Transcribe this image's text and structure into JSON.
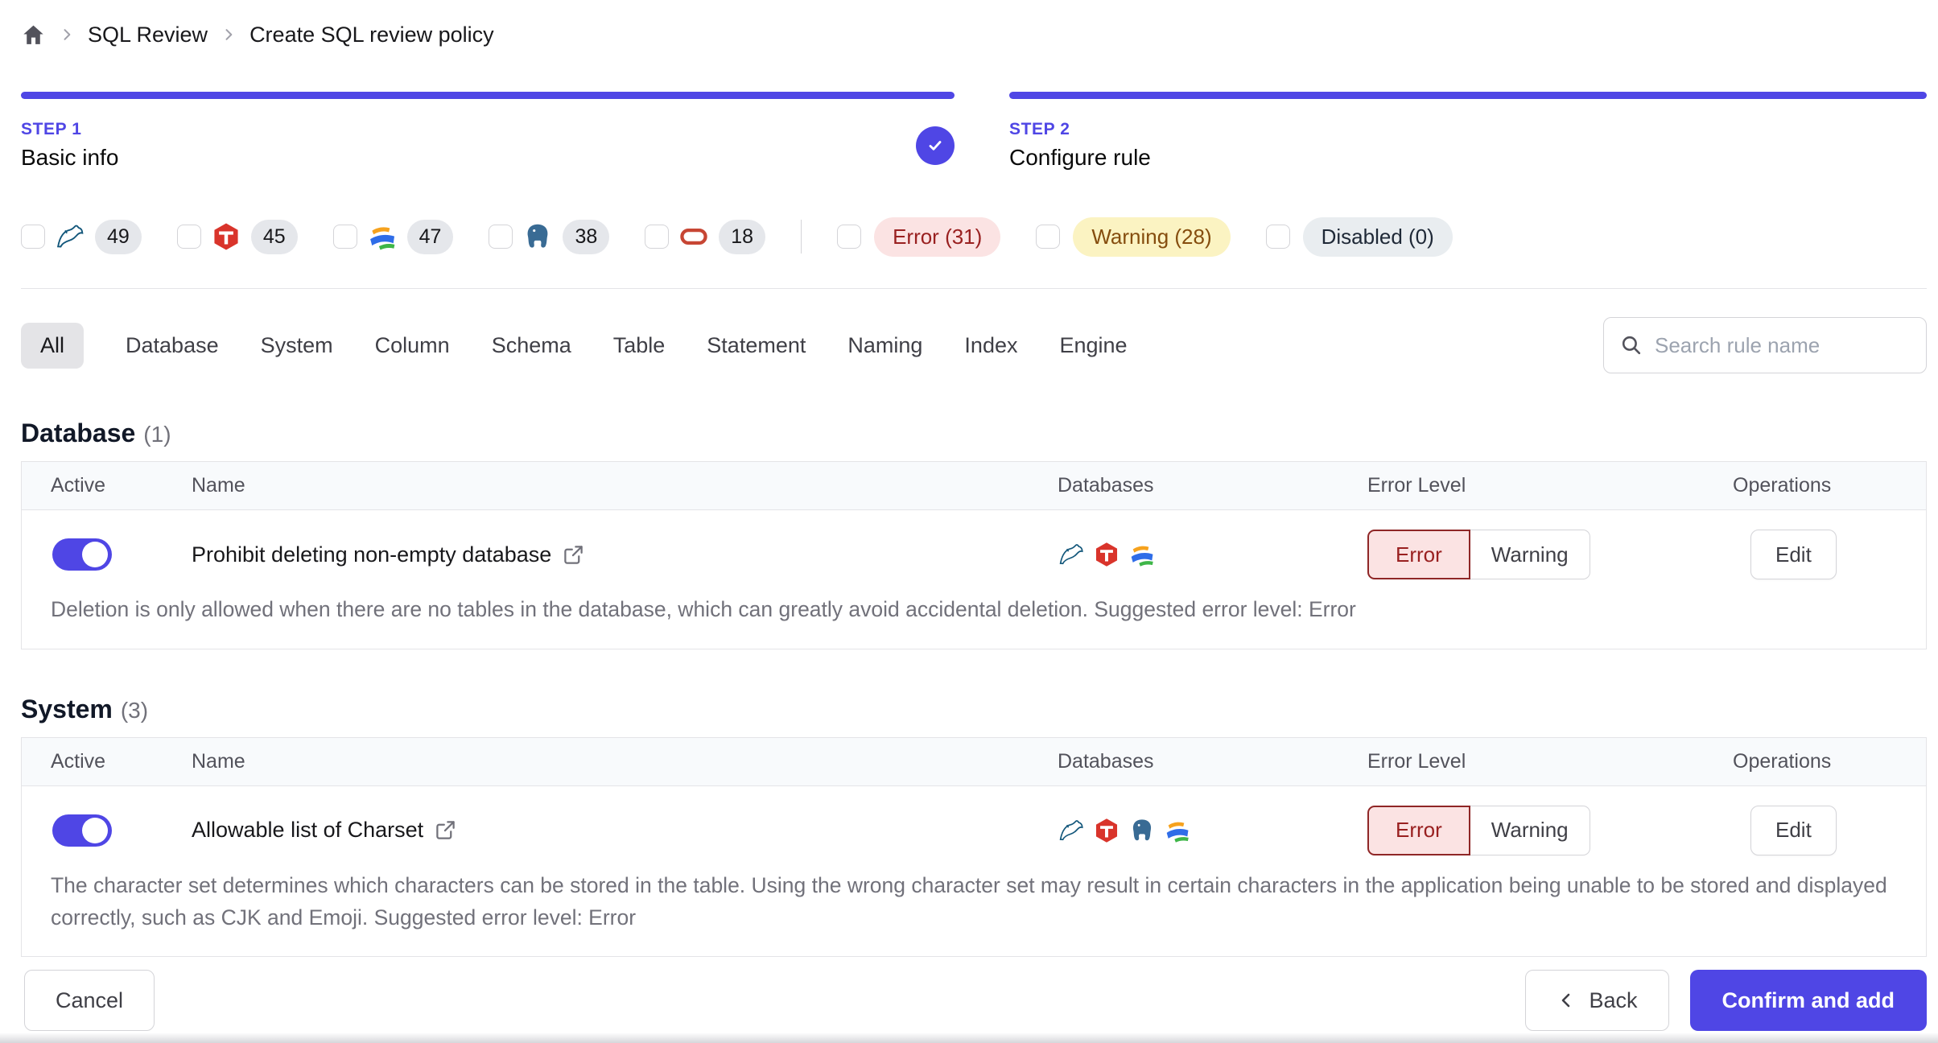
{
  "breadcrumb": {
    "items": [
      "SQL Review",
      "Create SQL review policy"
    ]
  },
  "steps": [
    {
      "label": "STEP 1",
      "title": "Basic info",
      "completed": true
    },
    {
      "label": "STEP 2",
      "title": "Configure rule",
      "completed": false
    }
  ],
  "filters": {
    "engines": [
      {
        "icon": "mysql-icon",
        "count": "49"
      },
      {
        "icon": "tidb-icon",
        "count": "45"
      },
      {
        "icon": "oceanbase-icon",
        "count": "47"
      },
      {
        "icon": "postgresql-icon",
        "count": "38"
      },
      {
        "icon": "oracle-icon",
        "count": "18"
      }
    ],
    "levels": [
      {
        "label": "Error (31)",
        "type": "error"
      },
      {
        "label": "Warning (28)",
        "type": "warning"
      },
      {
        "label": "Disabled (0)",
        "type": "disabled"
      }
    ]
  },
  "tabs": [
    "All",
    "Database",
    "System",
    "Column",
    "Schema",
    "Table",
    "Statement",
    "Naming",
    "Index",
    "Engine"
  ],
  "search": {
    "placeholder": "Search rule name"
  },
  "table_headers": [
    "Active",
    "Name",
    "Databases",
    "Error Level",
    "Operations"
  ],
  "sections": [
    {
      "title": "Database",
      "count": "(1)",
      "rules": [
        {
          "name": "Prohibit deleting non-empty database",
          "active": true,
          "engines": [
            "mysql-icon",
            "tidb-icon",
            "oceanbase-icon"
          ],
          "level": "Error",
          "description": "Deletion is only allowed when there are no tables in the database, which can greatly avoid accidental deletion. Suggested error level: Error"
        }
      ]
    },
    {
      "title": "System",
      "count": "(3)",
      "rules": [
        {
          "name": "Allowable list of Charset",
          "active": true,
          "engines": [
            "mysql-icon",
            "tidb-icon",
            "postgresql-icon",
            "oceanbase-icon"
          ],
          "level": "Error",
          "description": "The character set determines which characters can be stored in the table. Using the wrong character set may result in certain characters in the application being unable to be stored and displayed correctly, such as CJK and Emoji. Suggested error level: Error"
        }
      ]
    }
  ],
  "buttons": {
    "error": "Error",
    "warning": "Warning",
    "edit": "Edit",
    "cancel": "Cancel",
    "back": "Back",
    "confirm": "Confirm and add"
  },
  "colors": {
    "accent": "#4f46e5",
    "error-bg": "#fbe3e3",
    "error-text": "#992020",
    "error-border": "#8f2626",
    "warning-bg": "#fbf3c2",
    "warning-text": "#854d0e",
    "disabled-bg": "#e9edf0",
    "badge-bg": "#e5e7eb"
  }
}
